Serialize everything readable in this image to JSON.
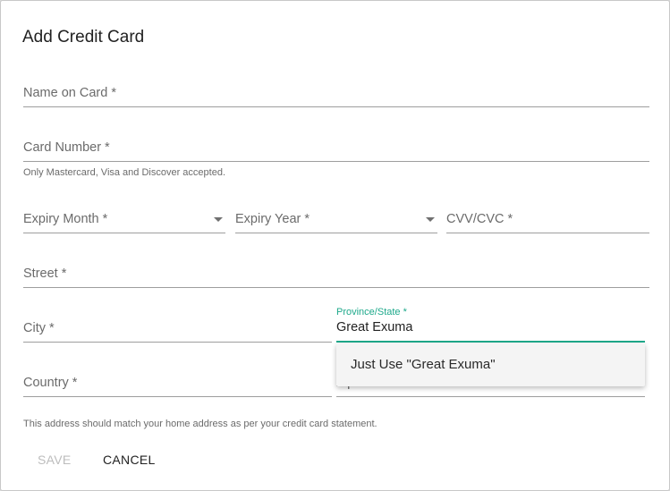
{
  "dialog": {
    "title": "Add Credit Card",
    "fields": {
      "name_on_card": "Name on Card *",
      "card_number": "Card Number *",
      "card_helper": "Only Mastercard, Visa and Discover accepted.",
      "expiry_month": "Expiry Month *",
      "expiry_year": "Expiry Year *",
      "cvv": "CVV/CVC *",
      "street": "Street *",
      "city": "City *",
      "province_label": "Province/State *",
      "province_value": "Great Exuma",
      "country": "Country *",
      "postal_code": "Zip/Postal Code"
    },
    "address_helper": "This address should match your home address as per your credit card statement.",
    "autocomplete_option": "Just Use \"Great Exuma\"",
    "buttons": {
      "save": "SAVE",
      "cancel": "CANCEL"
    },
    "colors": {
      "accent": "#1ea98b",
      "disabled": "#bdbdbd"
    }
  }
}
